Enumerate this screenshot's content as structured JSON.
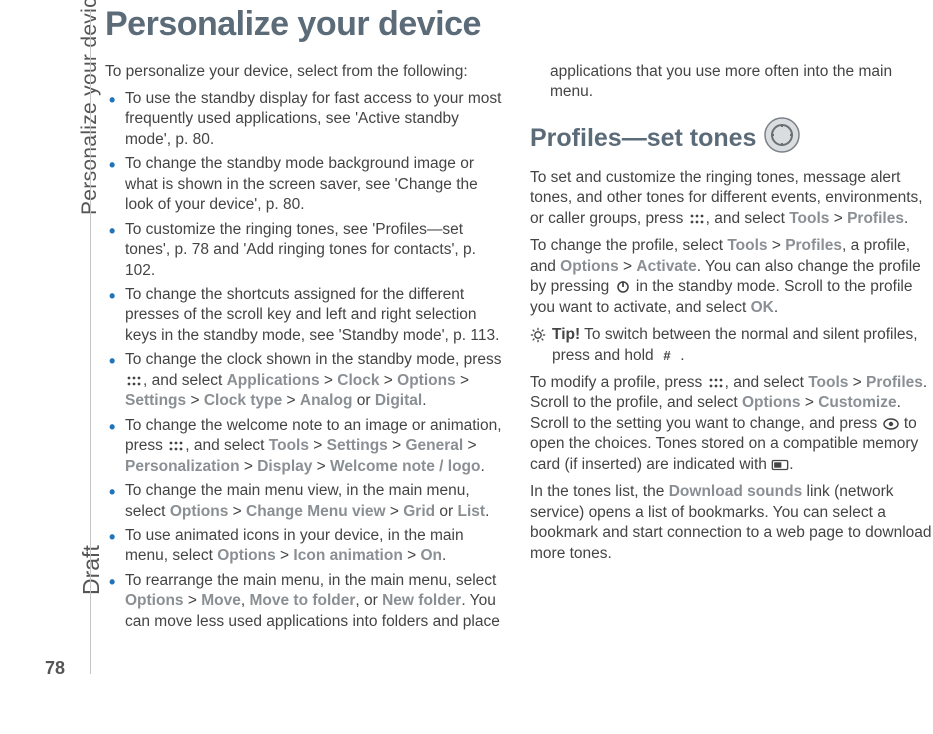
{
  "margin": {
    "section_label": "Personalize your device",
    "draft_label": "Draft",
    "page_number": "78"
  },
  "title": "Personalize your device",
  "intro": "To personalize your device, select from the following:",
  "bullets": [
    {
      "pre": "To use the standby display for fast access to your most frequently used applications, see 'Active standby mode', p. 80."
    },
    {
      "pre": "To change the standby mode background image or what is shown in the screen saver, see 'Change the look of your device', p. 80."
    },
    {
      "pre": "To customize the ringing tones, see 'Profiles—set tones', p. 78 and 'Add ringing tones for contacts', p. 102."
    },
    {
      "pre": "To change the shortcuts assigned for the different presses of the scroll key and left and right selection keys in the standby mode, see 'Standby mode', p. 113."
    },
    {
      "pre": "To change the clock shown in the standby mode, press ",
      "icon": "apps",
      "mid": ", and select ",
      "path": [
        "Applications",
        "Clock",
        "Options",
        "Settings",
        "Clock type"
      ],
      "tail_path": [
        "Analog",
        "or",
        "Digital"
      ],
      "post": "."
    },
    {
      "pre": "To change the welcome note to an image or animation, press ",
      "icon": "apps",
      "mid": ", and select ",
      "path": [
        "Tools",
        "Settings",
        "General",
        "Personalization",
        "Display",
        "Welcome note / logo"
      ],
      "post": "."
    },
    {
      "pre": "To change the main menu view, in the main menu, select ",
      "path": [
        "Options",
        "Change Menu view"
      ],
      "tail_path": [
        "Grid",
        "or",
        "List"
      ],
      "post": "."
    },
    {
      "pre": "To use animated icons in your device, in the main menu, select ",
      "path": [
        "Options",
        "Icon animation",
        "On"
      ],
      "post": "."
    },
    {
      "pre": "To rearrange the main menu, in the main menu, select ",
      "path_comma": [
        "Options",
        "Move",
        "Move to folder"
      ],
      "tail_or": "New folder",
      "post": ". You can move less used applications into folders and place applications that you use more often into the main menu."
    }
  ],
  "section2": {
    "heading": "Profiles—set tones",
    "p1_pre": "To set and customize the ringing tones, message alert tones, and other tones for different events, environments, or caller groups, press ",
    "p1_mid": ", and select ",
    "p1_path": [
      "Tools",
      "Profiles"
    ],
    "p1_post": ".",
    "p2_pre": "To change the profile, select ",
    "p2_path1": [
      "Tools",
      "Profiles"
    ],
    "p2_mid1": ", a profile, and ",
    "p2_path2": [
      "Options",
      "Activate"
    ],
    "p2_mid2": ". You can also change the profile by pressing ",
    "p2_mid3": " in the standby mode. Scroll to the profile you want to activate, and select ",
    "p2_ok": "OK",
    "p2_post": ".",
    "tip_label": "Tip!",
    "tip_text_pre": " To switch between the normal and silent profiles, press and hold ",
    "tip_text_post": " .",
    "p3_pre": "To modify a profile, press ",
    "p3_mid1": ", and select ",
    "p3_path1": [
      "Tools",
      "Profiles"
    ],
    "p3_mid2": ". Scroll to the profile, and select ",
    "p3_path2": [
      "Options",
      "Customize"
    ],
    "p3_mid3": ". Scroll to the setting you want to change, and press ",
    "p3_mid4": " to open the choices. Tones stored on a compatible memory card (if inserted) are indicated with ",
    "p3_post": ".",
    "p4_pre": "In the tones list, the ",
    "p4_link": "Download sounds",
    "p4_post": " link (network service) opens a list of bookmarks. You can select a bookmark and start connection to a web page to download more tones."
  }
}
